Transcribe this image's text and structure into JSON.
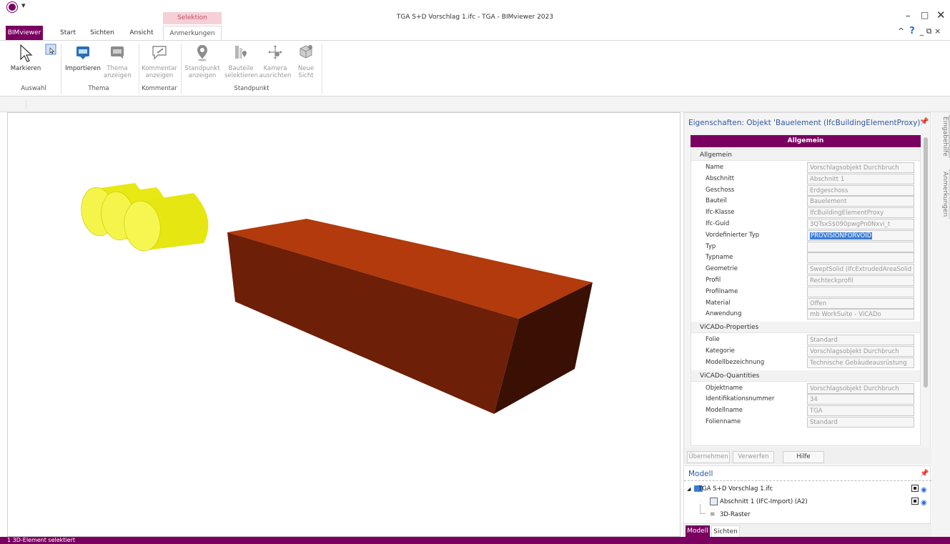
{
  "window": {
    "title": "TGA S+D Vorschlag 1.ifc - TGA - BIMviewer 2023",
    "context_group": "Selektion",
    "minimize": "–",
    "maximize": "□",
    "close": "✕"
  },
  "tabs": {
    "bimviewer": "BIMviewer",
    "start": "Start",
    "sichten": "Sichten",
    "ansicht": "Ansicht",
    "anmerkungen": "Anmerkungen"
  },
  "ribbon_right": {
    "collapse": "^",
    "help": "?",
    "minimize": "_",
    "restore": "⧉",
    "close": "×"
  },
  "ribbon": {
    "markieren": "Markieren",
    "importieren": "Importieren",
    "thema_anzeigen_1": "Thema",
    "thema_anzeigen_2": "anzeigen",
    "kommentar_1": "Kommentar",
    "kommentar_2": "anzeigen",
    "standpunkt_1": "Standpunkt",
    "standpunkt_2": "anzeigen",
    "bauteile_1": "Bauteile",
    "bauteile_2": "selektieren",
    "kamera_1": "Kamera",
    "kamera_2": "ausrichten",
    "neue_1": "Neue",
    "neue_2": "Sicht",
    "groups": {
      "auswahl": "Auswahl",
      "thema": "Thema",
      "kommentar": "Kommentar",
      "standpunkt": "Standpunkt"
    }
  },
  "colors": {
    "brand": "#7a0060",
    "cylinder": "#f0f020",
    "box_top": "#b23a0c",
    "box_front": "#6e1f08",
    "box_side": "#3a1004",
    "selection": "#3d7cd6",
    "link": "#2e58a6"
  },
  "props": {
    "title": "Eigenschaften: Objekt 'Bauelement (IfcBuildingElementProxy)'",
    "header": "Allgemein",
    "sections": [
      {
        "label": "Allgemein",
        "rows": [
          {
            "k": "Name",
            "v": "Vorschlagsobjekt Durchbruch"
          },
          {
            "k": "Abschnitt",
            "v": "Abschnitt 1"
          },
          {
            "k": "Geschoss",
            "v": "Erdgeschoss"
          },
          {
            "k": "Bauteil",
            "v": "Bauelement"
          },
          {
            "k": "Ifc-Klasse",
            "v": "IfcBuildingElementProxy"
          },
          {
            "k": "Ifc-Guid",
            "v": "3QTsxS$090pwgPn0Nxvi_t"
          },
          {
            "k": "Vordefinierter Typ",
            "v": "PROVISIONFORVOID"
          },
          {
            "k": "Typ",
            "v": ""
          },
          {
            "k": "Typname",
            "v": ""
          },
          {
            "k": "Geometrie",
            "v": "SweptSolid (IfcExtrudedAreaSolid"
          },
          {
            "k": "Profil",
            "v": "Rechteckprofil"
          },
          {
            "k": "Profilname",
            "v": ""
          },
          {
            "k": "Material",
            "v": "Offen"
          },
          {
            "k": "Anwendung",
            "v": "mb WorkSuite - ViCADo"
          }
        ]
      },
      {
        "label": "ViCADo-Properties",
        "rows": [
          {
            "k": "Folie",
            "v": "Standard"
          },
          {
            "k": "Kategorie",
            "v": "Vorschlagsobjekt Durchbruch"
          },
          {
            "k": "Modellbezeichnung",
            "v": "Technische Gebäudeausrüstung"
          }
        ]
      },
      {
        "label": "ViCADo-Quantities",
        "rows": [
          {
            "k": "Objektname",
            "v": "Vorschlagsobjekt Durchbruch"
          },
          {
            "k": "Identifikationsnummer",
            "v": "34"
          },
          {
            "k": "Modellname",
            "v": "TGA"
          },
          {
            "k": "Folienname",
            "v": "Standard"
          }
        ]
      }
    ],
    "buttons": {
      "uebernehmen": "Übernehmen",
      "verwerfen": "Verwerfen",
      "hilfe": "Hilfe"
    }
  },
  "model": {
    "title": "Modell",
    "tree": [
      {
        "label": "TGA S+D Vorschlag 1.ifc"
      },
      {
        "label": "Abschnitt 1 (IFC-Import) (A2)"
      },
      {
        "label": "3D-Raster"
      }
    ],
    "tabs": {
      "modell": "Modell",
      "sichten": "Sichten"
    }
  },
  "side_tabs": {
    "eingabehilfe": "Eingabehilfe",
    "anmerkungen": "Anmerkungen"
  },
  "status": "1 3D-Element selektiert"
}
